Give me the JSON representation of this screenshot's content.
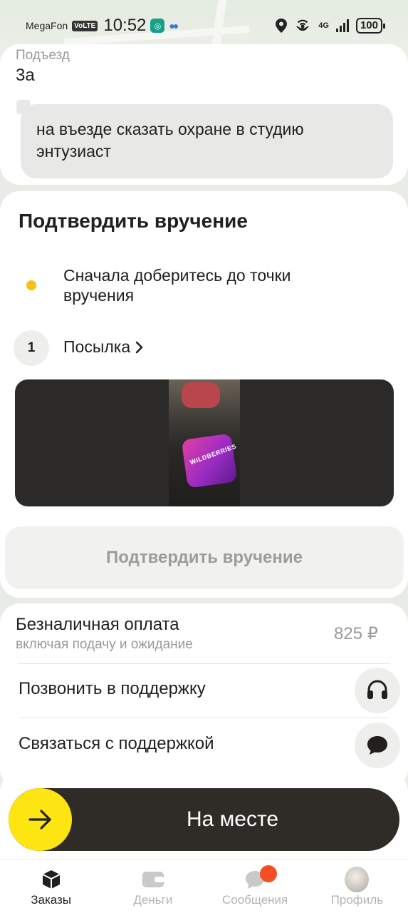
{
  "status_bar": {
    "carrier": "MegaFon",
    "volte": "VoLTE",
    "time": "10:52",
    "network": "4G",
    "battery": "100"
  },
  "address": {
    "entrance_label": "Подъезд",
    "entrance_value": "3а",
    "comment": "на въезде сказать охране в студию энтузиаст"
  },
  "confirm": {
    "title": "Подтвердить вручение",
    "status_text": "Сначала доберитесь до точки вручения",
    "status_color": "#fbbe14",
    "parcel_count": "1",
    "parcel_label": "Посылка",
    "photo_brand_text": "WILDBERRIES",
    "button_label": "Подтвердить вручение"
  },
  "payment": {
    "title": "Безналичная оплата",
    "subtitle": "включая подачу и ожидание",
    "amount": "825 ₽"
  },
  "support": {
    "call_label": "Позвонить в поддержку",
    "call_icon": "headset-icon",
    "chat_label": "Связаться с поддержкой",
    "chat_icon": "chat-bubble-icon"
  },
  "action": {
    "slider_label": "На месте",
    "knob_icon": "arrow-right-icon",
    "accent": "#fde511"
  },
  "tabs": [
    {
      "label": "Заказы",
      "icon": "package-icon",
      "active": true
    },
    {
      "label": "Деньги",
      "icon": "wallet-icon",
      "active": false
    },
    {
      "label": "Сообщения",
      "icon": "messages-icon",
      "active": false
    },
    {
      "label": "Профиль",
      "icon": "avatar",
      "active": false
    }
  ]
}
